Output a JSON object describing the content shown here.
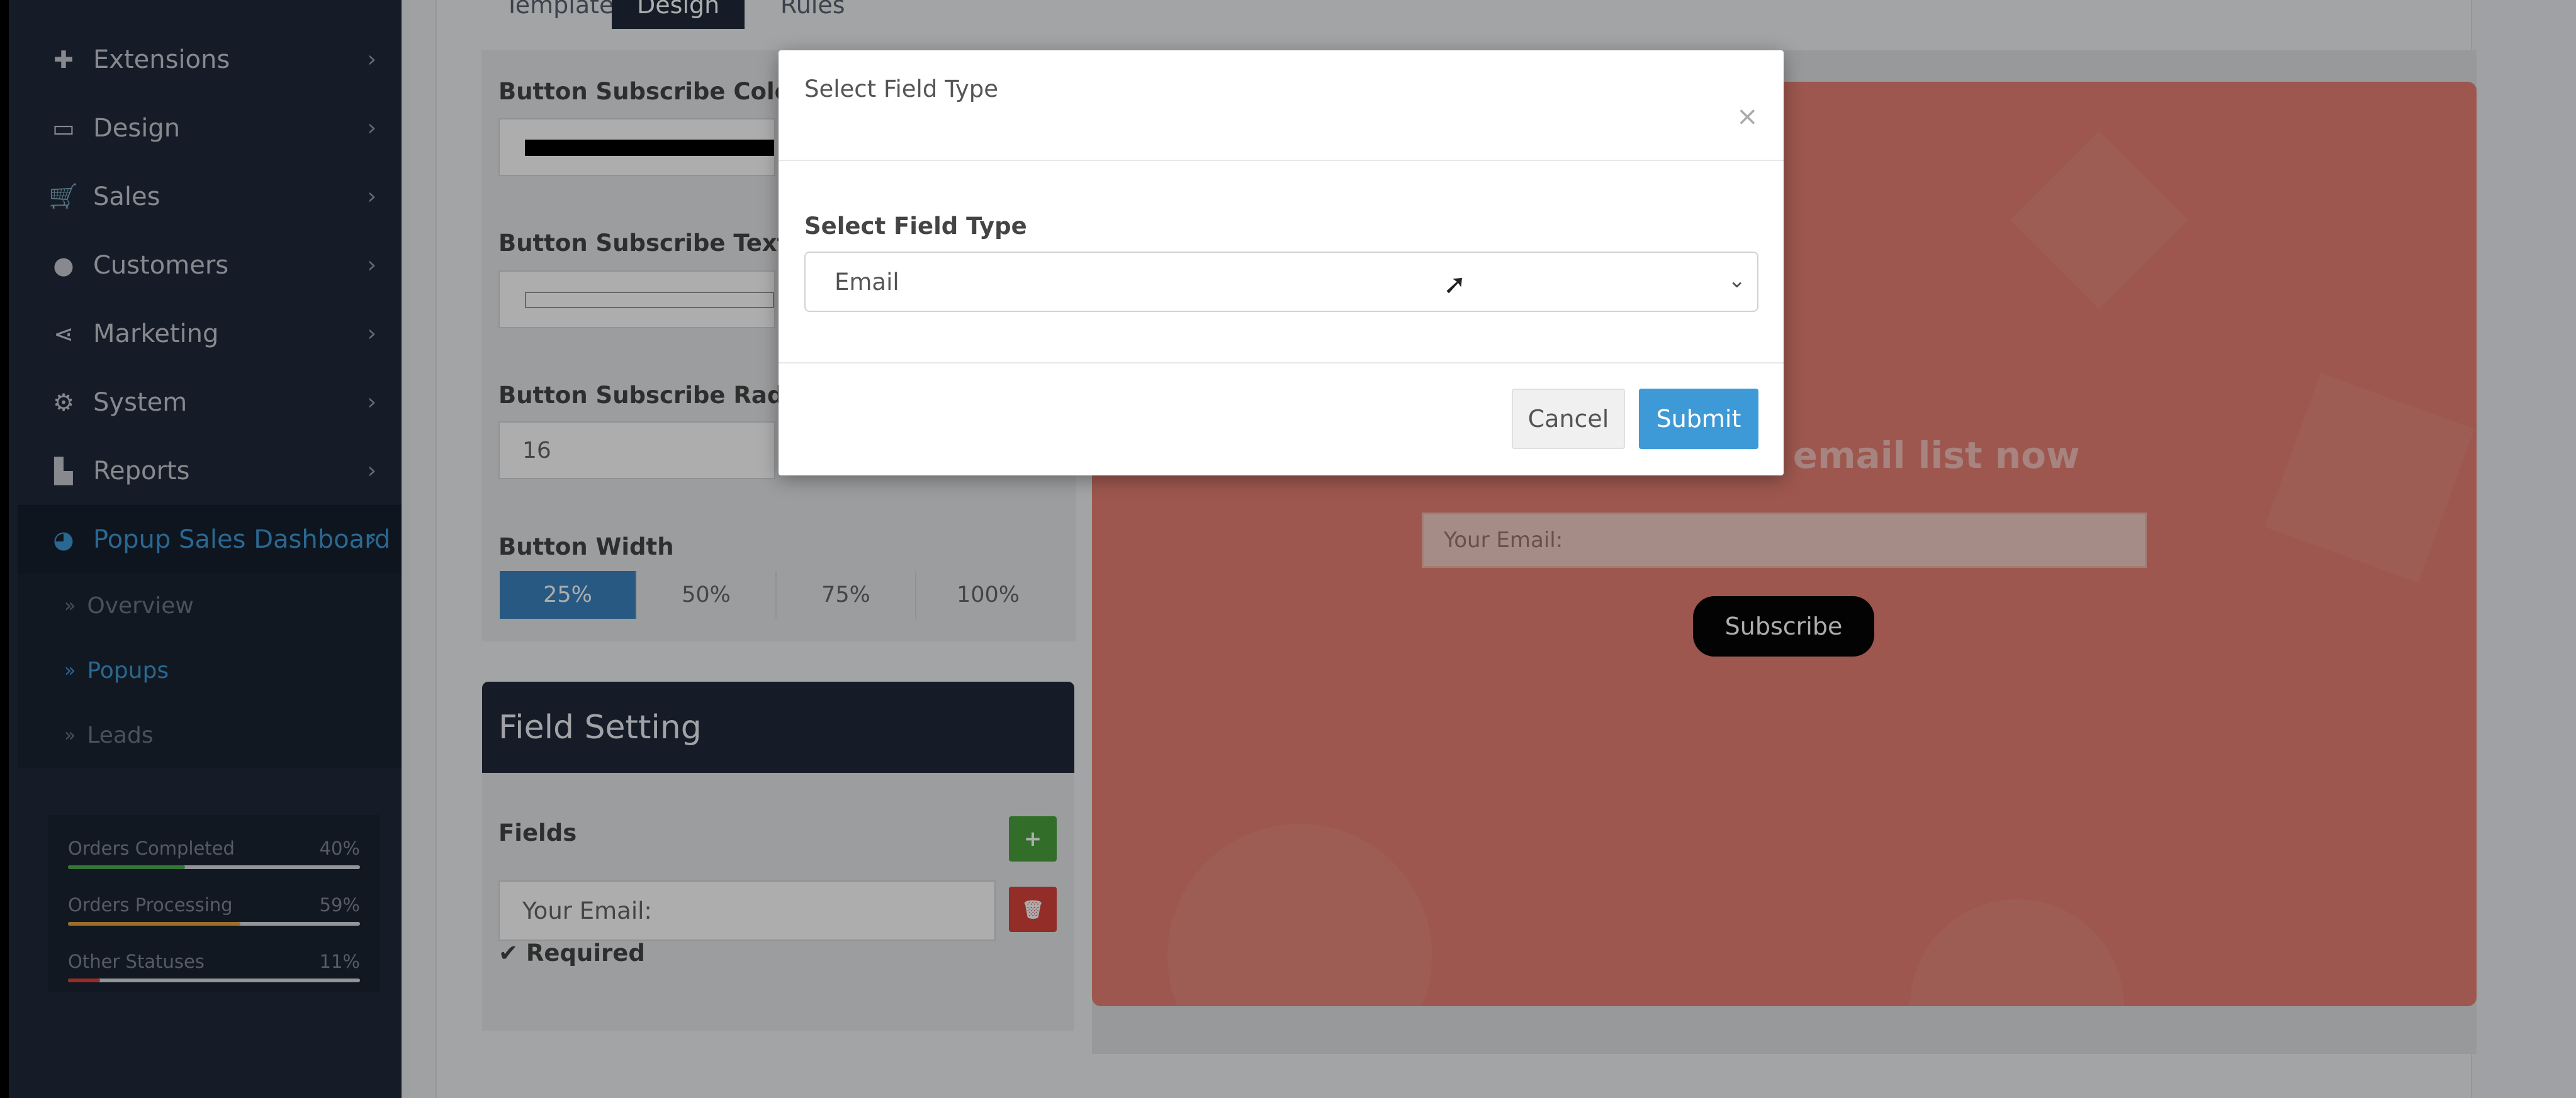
{
  "sidebar": {
    "items": [
      {
        "label": "Extensions",
        "icon": "puzzle-icon"
      },
      {
        "label": "Design",
        "icon": "monitor-icon"
      },
      {
        "label": "Sales",
        "icon": "cart-icon"
      },
      {
        "label": "Customers",
        "icon": "user-icon"
      },
      {
        "label": "Marketing",
        "icon": "share-icon"
      },
      {
        "label": "System",
        "icon": "gear-icon"
      },
      {
        "label": "Reports",
        "icon": "bar-chart-icon"
      },
      {
        "label": "Popup Sales Dashboard",
        "icon": "dashboard-icon"
      }
    ],
    "subitems": [
      "Overview",
      "Popups",
      "Leads"
    ],
    "stats": [
      {
        "label": "Orders Completed",
        "value": "40%",
        "fraction": 0.4,
        "color": "#4caf50"
      },
      {
        "label": "Orders Processing",
        "value": "59%",
        "fraction": 0.59,
        "color": "#e8a33d"
      },
      {
        "label": "Other Statuses",
        "value": "11%",
        "fraction": 0.11,
        "color": "#e0433a"
      }
    ]
  },
  "tabs": [
    "Template",
    "Design",
    "Rules"
  ],
  "design": {
    "btn_color_label": "Button Subscribe Color",
    "btn_text_color_label": "Button Subscribe Text Col",
    "btn_radius_label": "Button Subscribe Radius",
    "btn_radius_value": "16",
    "btn_width_label": "Button Width",
    "width_options": [
      "25%",
      "50%",
      "75%",
      "100%"
    ]
  },
  "field_setting": {
    "title": "Field Setting",
    "fields_label": "Fields",
    "field_value": "Your Email:",
    "required_label": "Required"
  },
  "preview": {
    "title": "r email list now",
    "email_placeholder": "Your Email:",
    "subscribe": "Subscribe"
  },
  "modal": {
    "title": "Select Field Type",
    "label": "Select Field Type",
    "selected": "Email",
    "cancel": "Cancel",
    "submit": "Submit"
  }
}
